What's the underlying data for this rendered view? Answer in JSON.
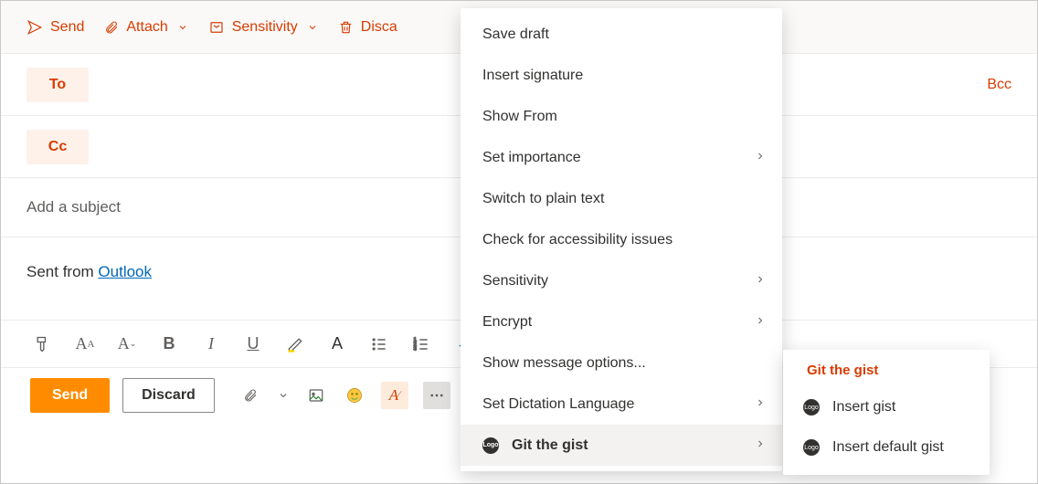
{
  "toolbar": {
    "send": "Send",
    "attach": "Attach",
    "sensitivity": "Sensitivity",
    "discard": "Discard"
  },
  "fields": {
    "to": "To",
    "cc": "Cc",
    "bcc": "Bcc",
    "subject_placeholder": "Add a subject"
  },
  "body": {
    "prefix": "Sent from ",
    "link_text": "Outlook"
  },
  "bottom": {
    "send": "Send",
    "discard": "Discard"
  },
  "menu": {
    "items": [
      {
        "label": "Save draft",
        "submenu": false
      },
      {
        "label": "Insert signature",
        "submenu": false
      },
      {
        "label": "Show From",
        "submenu": false
      },
      {
        "label": "Set importance",
        "submenu": true
      },
      {
        "label": "Switch to plain text",
        "submenu": false
      },
      {
        "label": "Check for accessibility issues",
        "submenu": false
      },
      {
        "label": "Sensitivity",
        "submenu": true
      },
      {
        "label": "Encrypt",
        "submenu": true
      },
      {
        "label": "Show message options...",
        "submenu": false
      },
      {
        "label": "Set Dictation Language",
        "submenu": true
      },
      {
        "label": "Git the gist",
        "submenu": true,
        "hovered": true,
        "logo": true
      }
    ]
  },
  "submenu": {
    "header": "Git the gist",
    "items": [
      {
        "label": "Insert gist"
      },
      {
        "label": "Insert default gist"
      }
    ]
  }
}
